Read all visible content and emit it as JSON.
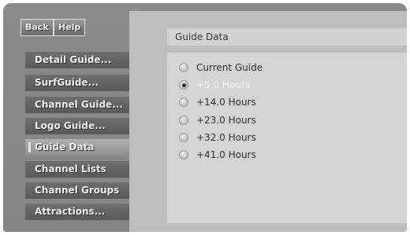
{
  "header": {
    "back_label": "Back",
    "help_label": "Help"
  },
  "sidebar": {
    "items": [
      {
        "label": "Detail Guide..."
      },
      {
        "label": "SurfGuide..."
      },
      {
        "label": "Channel Guide..."
      },
      {
        "label": "Logo Guide..."
      },
      {
        "label": "Guide Data",
        "selected": true
      },
      {
        "label": "Channel Lists"
      },
      {
        "label": "Channel Groups"
      },
      {
        "label": "Attractions..."
      }
    ]
  },
  "main": {
    "title": "Guide Data",
    "options": [
      {
        "label": "Current Guide",
        "checked": false
      },
      {
        "label": "+5.0 Hours",
        "checked": true
      },
      {
        "label": "+14.0 Hours",
        "checked": false
      },
      {
        "label": "+23.0 Hours",
        "checked": false
      },
      {
        "label": "+32.0 Hours",
        "checked": false
      },
      {
        "label": "+41.0 Hours",
        "checked": false
      }
    ]
  },
  "colors": {
    "panel": "#8a8a8a",
    "content": "#bdbdbd",
    "nav_button": "#666666",
    "nav_selected": "#a3a3a3"
  }
}
